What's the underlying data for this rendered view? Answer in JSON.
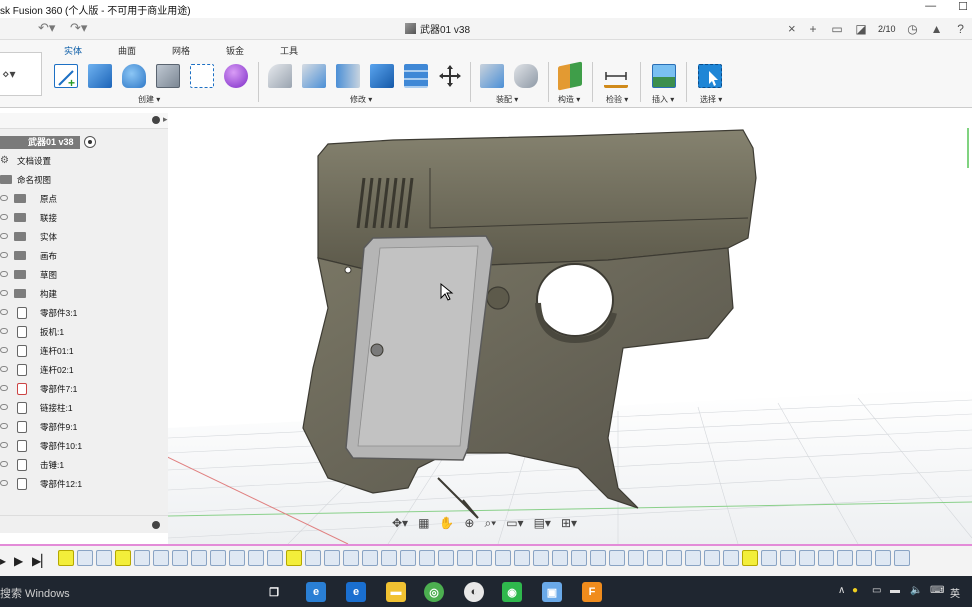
{
  "window": {
    "title": "sk Fusion 360 (个人版 - 不可用于商业用途)",
    "minimize": "—",
    "maximize": "☐"
  },
  "document": {
    "tab_title": "武器01 v38",
    "job_count": "2/10"
  },
  "ribbon": {
    "tabs": [
      "实体",
      "曲面",
      "网格",
      "钣金",
      "工具"
    ],
    "active_tab": "实体",
    "groups": [
      "创建 ▾",
      "修改 ▾",
      "装配 ▾",
      "构造 ▾",
      "检验 ▾",
      "插入 ▾",
      "选择 ▾"
    ]
  },
  "browser": {
    "root": "武器01 v38",
    "items": [
      {
        "label": "文档设置",
        "kind": "settings"
      },
      {
        "label": "命名视图",
        "kind": "folder-top"
      },
      {
        "label": "原点",
        "kind": "folder"
      },
      {
        "label": "联接",
        "kind": "folder"
      },
      {
        "label": "实体",
        "kind": "folder"
      },
      {
        "label": "画布",
        "kind": "folder"
      },
      {
        "label": "草图",
        "kind": "folder"
      },
      {
        "label": "构建",
        "kind": "folder"
      },
      {
        "label": "零部件3:1",
        "kind": "component"
      },
      {
        "label": "扳机:1",
        "kind": "component"
      },
      {
        "label": "连杆01:1",
        "kind": "component"
      },
      {
        "label": "连杆02:1",
        "kind": "component"
      },
      {
        "label": "零部件7:1",
        "kind": "component"
      },
      {
        "label": "链接柱:1",
        "kind": "component"
      },
      {
        "label": "零部件9:1",
        "kind": "component"
      },
      {
        "label": "零部件10:1",
        "kind": "component"
      },
      {
        "label": "击锤:1",
        "kind": "component"
      },
      {
        "label": "零部件12:1",
        "kind": "component"
      }
    ]
  },
  "taskbar": {
    "search_placeholder": "搜索 Windows",
    "ime": "英"
  },
  "colors": {
    "accent": "#0f6dbf",
    "gun_body": "#6f6c5c",
    "grip_panel": "#b5b5b5",
    "timeline_border": "#e38bd8"
  }
}
